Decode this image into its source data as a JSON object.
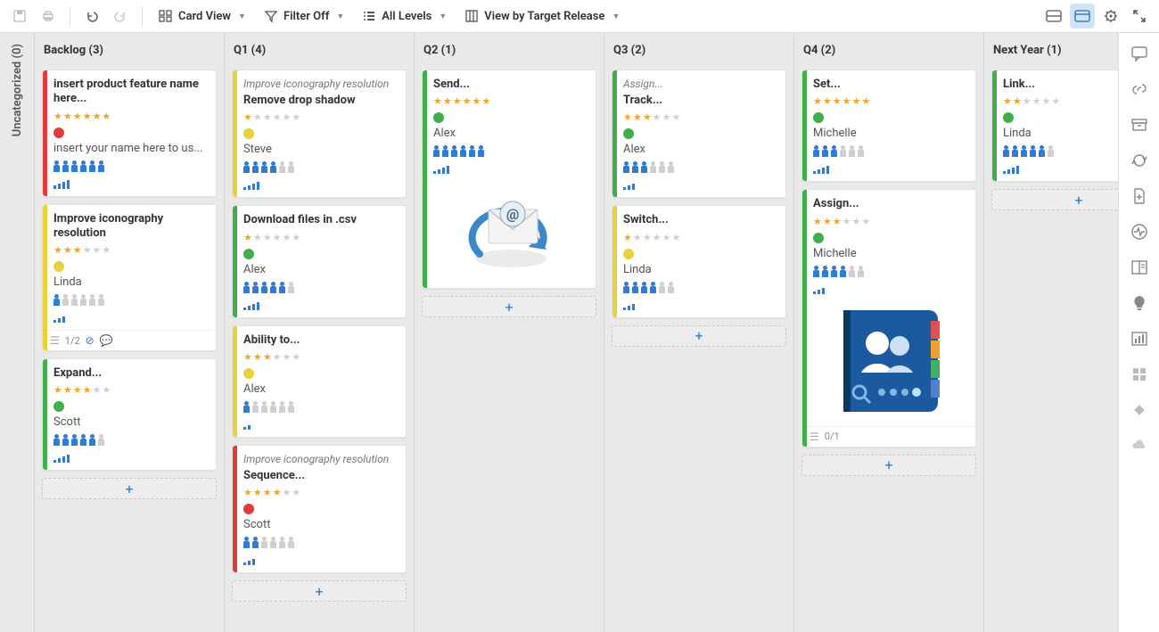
{
  "toolbar": {
    "card_view": "Card View",
    "filter": "Filter Off",
    "levels": "All Levels",
    "view_by": "View by Target Release"
  },
  "left_strip": "Uncategorized (0)",
  "columns": [
    {
      "key": "backlog",
      "header": "Backlog (3)"
    },
    {
      "key": "q1",
      "header": "Q1 (4)"
    },
    {
      "key": "q2",
      "header": "Q2 (1)"
    },
    {
      "key": "q3",
      "header": "Q3 (2)"
    },
    {
      "key": "q4",
      "header": "Q4 (2)"
    },
    {
      "key": "next",
      "header": "Next Year (1)"
    }
  ],
  "cards": {
    "backlog": [
      {
        "stripe": "red",
        "title": "insert product feature name here...",
        "stars": 6,
        "stars_on": 6,
        "dot": "red",
        "assignee": "insert your name here to us...",
        "people_blue": 6,
        "people_grey": 0,
        "bars": [
          4,
          6,
          8,
          10
        ]
      },
      {
        "stripe": "yellow",
        "title": "Improve iconography resolution",
        "stars": 6,
        "stars_on": 3,
        "dot": "yellow",
        "assignee": "Linda",
        "people_blue": 1,
        "people_grey": 5,
        "bars": [
          3,
          5,
          7
        ],
        "footer": {
          "count": "1/2",
          "link": true,
          "comment": true
        }
      },
      {
        "stripe": "green",
        "title": "Expand...",
        "stars": 6,
        "stars_on": 4,
        "dot": "green",
        "assignee": "Scott",
        "people_blue": 5,
        "people_grey": 1,
        "bars": [
          3,
          5,
          7,
          9
        ]
      }
    ],
    "q1": [
      {
        "stripe": "yellow",
        "epic": "Improve iconography resolution",
        "title": "Remove drop shadow",
        "stars": 6,
        "stars_on": 1,
        "dot": "yellow",
        "assignee": "Steve",
        "people_blue": 4,
        "people_grey": 2,
        "bars": [
          3,
          5,
          7,
          9
        ]
      },
      {
        "stripe": "green",
        "title": "Download files in .csv",
        "stars": 6,
        "stars_on": 1,
        "dot": "green",
        "assignee": "Alex",
        "people_blue": 5,
        "people_grey": 1,
        "bars": [
          3,
          5,
          7,
          9
        ]
      },
      {
        "stripe": "yellow",
        "title": "Ability to...",
        "stars": 6,
        "stars_on": 3,
        "dot": "yellow",
        "assignee": "Alex",
        "people_blue": 1,
        "people_grey": 5,
        "bars": [
          3,
          5
        ]
      },
      {
        "stripe": "red",
        "epic": "Improve iconography resolution",
        "title": "Sequence...",
        "stars": 6,
        "stars_on": 4,
        "dot": "red",
        "assignee": "Scott",
        "people_blue": 2,
        "people_grey": 4,
        "bars": [
          3,
          5,
          7
        ]
      }
    ],
    "q2": [
      {
        "stripe": "green",
        "title": "Send...",
        "stars": 6,
        "stars_on": 6,
        "dot": "green",
        "assignee": "Alex",
        "people_blue": 6,
        "people_grey": 0,
        "bars": [
          3,
          5,
          7,
          9
        ],
        "image": "mail"
      }
    ],
    "q3": [
      {
        "stripe": "green",
        "epic": "Assign...",
        "title": "Track...",
        "stars": 6,
        "stars_on": 3,
        "dot": "green",
        "assignee": "Alex",
        "people_blue": 3,
        "people_grey": 3,
        "bars": [
          3,
          5,
          7
        ]
      },
      {
        "stripe": "yellow",
        "title": "Switch...",
        "stars": 6,
        "stars_on": 1,
        "dot": "yellow",
        "assignee": "Linda",
        "people_blue": 4,
        "people_grey": 2,
        "bars": [
          3,
          5,
          7
        ]
      }
    ],
    "q4": [
      {
        "stripe": "green",
        "title": "Set...",
        "stars": 6,
        "stars_on": 6,
        "dot": "green",
        "assignee": "Michelle",
        "people_blue": 3,
        "people_grey": 3,
        "bars": [
          3,
          5,
          7,
          9
        ]
      },
      {
        "stripe": "green",
        "title": "Assign...",
        "stars": 6,
        "stars_on": 3,
        "dot": "green",
        "assignee": "Michelle",
        "people_blue": 4,
        "people_grey": 2,
        "bars": [
          3,
          5,
          7
        ],
        "image": "contacts",
        "footer": {
          "count": "0/1"
        }
      }
    ],
    "next": [
      {
        "stripe": "green",
        "title": "Link...",
        "stars": 6,
        "stars_on": 2,
        "dot": "green",
        "assignee": "Linda",
        "people_blue": 5,
        "people_grey": 1,
        "bars": [
          3,
          5,
          7,
          9
        ]
      }
    ]
  }
}
